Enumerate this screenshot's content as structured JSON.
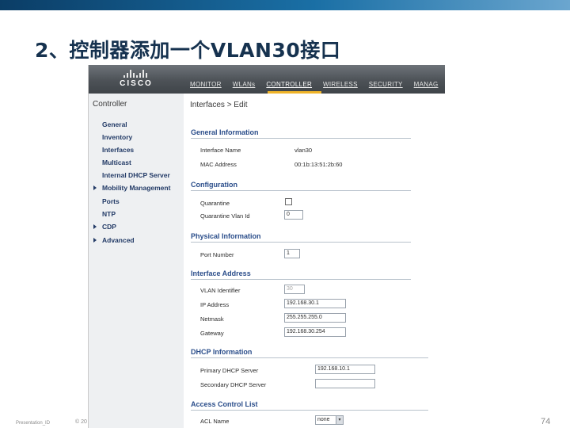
{
  "slide": {
    "title": "2、控制器添加一个VLAN30接口",
    "footer_left": "Presentation_ID",
    "footer_copy": "© 20",
    "page_number": "74",
    "accent_color": "#1a6fa5"
  },
  "wlc": {
    "logo_text": "CISCO",
    "menu": [
      "MONITOR",
      "WLANs",
      "CONTROLLER",
      "WIRELESS",
      "SECURITY",
      "MANAG"
    ],
    "active_menu": "CONTROLLER",
    "nav_heading": "Controller",
    "nav_items": [
      "General",
      "Inventory",
      "Interfaces",
      "Multicast",
      "Internal DHCP Server",
      "Mobility Management",
      "Ports",
      "NTP",
      "CDP",
      "Advanced"
    ],
    "breadcrumb": "Interfaces > Edit",
    "general": {
      "heading": "General Information",
      "interface_name_label": "Interface Name",
      "interface_name_value": "vlan30",
      "mac_label": "MAC Address",
      "mac_value": "00:1b:13:51:2b:60"
    },
    "configuration": {
      "heading": "Configuration",
      "quarantine_label": "Quarantine",
      "quarantine_vlan_label": "Quarantine Vlan Id",
      "quarantine_vlan_value": "0"
    },
    "physical": {
      "heading": "Physical Information",
      "port_label": "Port Number",
      "port_value": "1"
    },
    "address": {
      "heading": "Interface Address",
      "vlan_label": "VLAN Identifier",
      "vlan_value": "30",
      "ip_label": "IP Address",
      "ip_value": "192.168.30.1",
      "netmask_label": "Netmask",
      "netmask_value": "255.255.255.0",
      "gateway_label": "Gateway",
      "gateway_value": "192.168.30.254"
    },
    "dhcp": {
      "heading": "DHCP Information",
      "primary_label": "Primary DHCP Server",
      "primary_value": "192.168.10.1",
      "secondary_label": "Secondary DHCP Server",
      "secondary_value": ""
    },
    "acl": {
      "heading": "Access Control List",
      "acl_label": "ACL Name",
      "acl_value": "none"
    }
  }
}
